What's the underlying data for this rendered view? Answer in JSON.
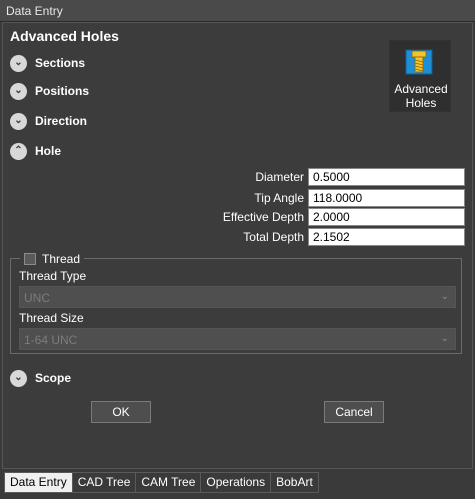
{
  "window": {
    "title": "Data Entry"
  },
  "header": {
    "title": "Advanced Holes"
  },
  "tool": {
    "label_line1": "Advanced",
    "label_line2": "Holes",
    "icon": "advanced-holes-icon"
  },
  "sections": {
    "sections": {
      "label": "Sections",
      "state": "collapsed"
    },
    "positions": {
      "label": "Positions",
      "state": "collapsed"
    },
    "direction": {
      "label": "Direction",
      "state": "collapsed"
    },
    "hole": {
      "label": "Hole",
      "state": "expanded"
    },
    "scope": {
      "label": "Scope",
      "state": "collapsed"
    }
  },
  "hole_fields": {
    "diameter": {
      "label": "Diameter",
      "value": "0.5000"
    },
    "tip_angle": {
      "label": "Tip Angle",
      "value": "118.0000"
    },
    "effective_depth": {
      "label": "Effective Depth",
      "value": "2.0000"
    },
    "total_depth": {
      "label": "Total Depth",
      "value": "2.1502"
    }
  },
  "thread": {
    "label": "Thread",
    "checked": false,
    "type_label": "Thread Type",
    "type_value": "UNC",
    "size_label": "Thread Size",
    "size_value": "1-64 UNC"
  },
  "buttons": {
    "ok": "OK",
    "cancel": "Cancel"
  },
  "tabs": [
    "Data Entry",
    "CAD Tree",
    "CAM Tree",
    "Operations",
    "BobArt"
  ],
  "active_tab": "Data Entry"
}
